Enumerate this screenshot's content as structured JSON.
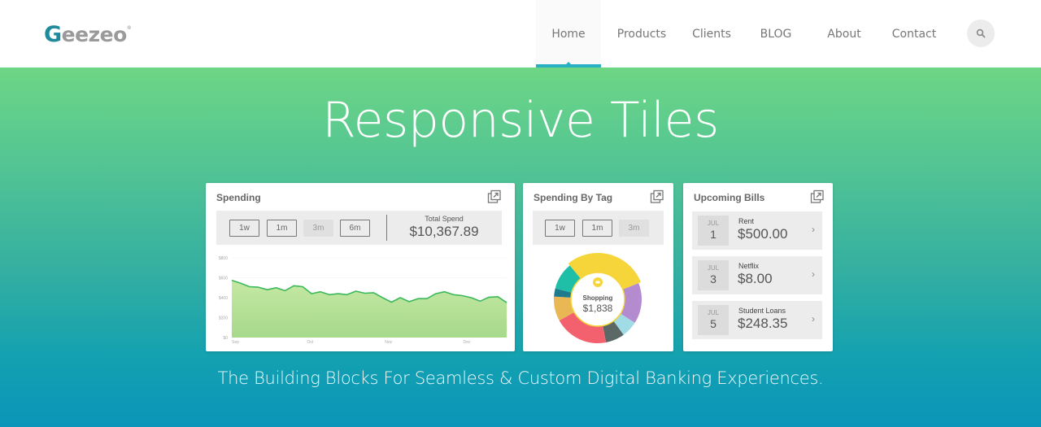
{
  "header": {
    "logo_initial": "G",
    "logo_rest": "eezeo",
    "logo_mark": "®",
    "nav": [
      {
        "label": "Home",
        "active": true
      },
      {
        "label": "Products",
        "active": false
      },
      {
        "label": "Clients",
        "active": false
      },
      {
        "label": "BLOG",
        "active": false
      },
      {
        "label": "About",
        "active": false
      },
      {
        "label": "Contact",
        "active": false
      }
    ],
    "search_icon": "search-icon"
  },
  "hero": {
    "title": "Responsive Tiles",
    "subtitle": "The Building Blocks For Seamless & Custom Digital Banking Experiences."
  },
  "tiles": {
    "spending": {
      "title": "Spending",
      "ranges": [
        {
          "label": "1w",
          "selected": false
        },
        {
          "label": "1m",
          "selected": false
        },
        {
          "label": "3m",
          "selected": true
        },
        {
          "label": "6m",
          "selected": false
        }
      ],
      "total_label": "Total Spend",
      "total_value": "$10,367.89"
    },
    "spending_by_tag": {
      "title": "Spending By Tag",
      "ranges": [
        {
          "label": "1w",
          "selected": false
        },
        {
          "label": "1m",
          "selected": false
        },
        {
          "label": "3m",
          "selected": true
        }
      ],
      "center_label": "Shopping",
      "center_value": "$1,838"
    },
    "upcoming_bills": {
      "title": "Upcoming Bills",
      "bills": [
        {
          "month": "JUL",
          "day": "1",
          "name": "Rent",
          "amount": "$500.00"
        },
        {
          "month": "JUL",
          "day": "3",
          "name": "Netflix",
          "amount": "$8.00"
        },
        {
          "month": "JUL",
          "day": "5",
          "name": "Student Loans",
          "amount": "$248.35"
        }
      ]
    }
  },
  "colors": {
    "brand": "#1f8a9b",
    "nav_accent": "#2ab0c4",
    "line": "#3cb95a",
    "area": "#a8dc8c"
  },
  "chart_data": [
    {
      "type": "area",
      "title": "Spending",
      "xlabel": "",
      "ylabel": "",
      "ylim": [
        0,
        800
      ],
      "yticks": [
        "$0",
        "$200",
        "$400",
        "$600",
        "$800"
      ],
      "xticks": [
        "Sep",
        "Oct",
        "Nov",
        "Dec"
      ],
      "grid": true,
      "series": [
        {
          "name": "Spending",
          "values": [
            575,
            545,
            510,
            505,
            480,
            500,
            470,
            520,
            510,
            440,
            460,
            430,
            440,
            430,
            465,
            445,
            450,
            400,
            355,
            400,
            360,
            390,
            390,
            440,
            460,
            430,
            420,
            400,
            365,
            405,
            410,
            350
          ]
        }
      ]
    },
    {
      "type": "pie",
      "title": "Spending By Tag",
      "donut": true,
      "highlighted": "Shopping",
      "center_value": "$1,838",
      "slices": [
        {
          "label": "Shopping",
          "share": 0.3,
          "color": "#f5d53a"
        },
        {
          "label": "Purple",
          "share": 0.15,
          "color": "#b58bd0"
        },
        {
          "label": "Light Blue",
          "share": 0.06,
          "color": "#a1dbe5"
        },
        {
          "label": "Dark Gray",
          "share": 0.07,
          "color": "#5b6866"
        },
        {
          "label": "Red",
          "share": 0.2,
          "color": "#f4616e"
        },
        {
          "label": "Orange",
          "share": 0.09,
          "color": "#e9b753"
        },
        {
          "label": "Navy",
          "share": 0.03,
          "color": "#1e7a8c"
        },
        {
          "label": "Teal",
          "share": 0.1,
          "color": "#1fbfa7"
        }
      ]
    }
  ]
}
